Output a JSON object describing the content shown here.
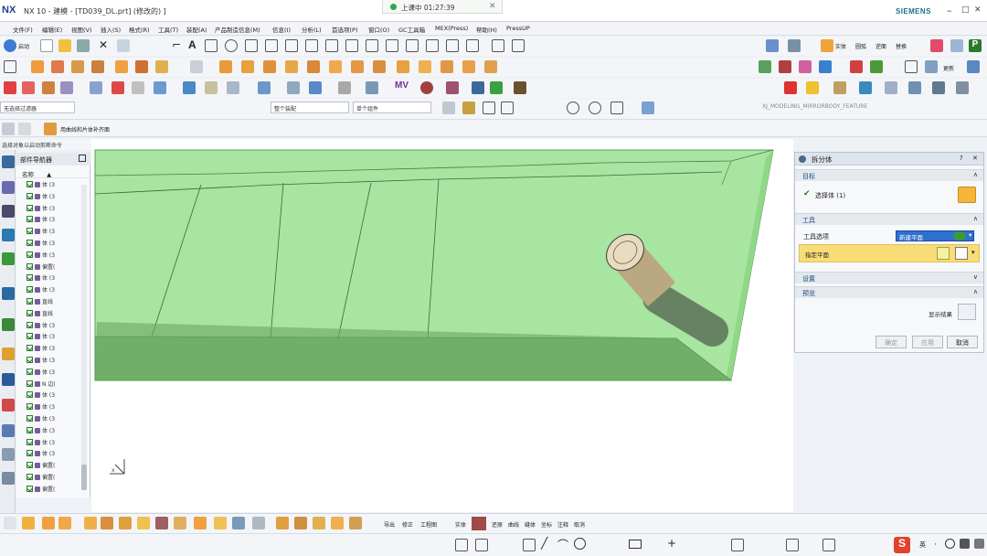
{
  "window": {
    "logo": "NX",
    "title": "NX 10 - 建模 - [TD039_DL.prt]  (修改的) ]",
    "brand": "SIEMENS",
    "minimize": "–",
    "maximize": "□",
    "close": "✕"
  },
  "recording": {
    "text": "上课中 01:27:39",
    "close": "✕"
  },
  "menu": [
    "文件(F)",
    "编辑(E)",
    "视图(V)",
    "插入(S)",
    "格式(R)",
    "工具(T)",
    "装配(A)",
    "产品制造信息(M)",
    "信息(I)",
    "分析(L)",
    "首选项(P)",
    "窗口(O)",
    "GC工具箱",
    "MEX(Press)",
    "帮助(H)",
    "PressUP"
  ],
  "toolbar_labels": {
    "start": "启动",
    "snap": "实体",
    "toggle": "圆弧",
    "reverse": "逆面",
    "replace": "替换",
    "insert": "图包",
    "view": "更新",
    "sel_feature": "XJ_MODELING_MIRRORBODY_FEATURE",
    "mv": "MV",
    "measure": "工程"
  },
  "selection": {
    "filter": "无选择过滤器",
    "scope": "整个装配",
    "section": "单个组件",
    "hint": "用曲线和片体补齐面",
    "status": "选择对象以启动剪断命令"
  },
  "navigator": {
    "title": "部件导航器",
    "col_name": "名称",
    "col_arrow": "▲",
    "rows": [
      "体 (3",
      "体 (3",
      "体 (3",
      "体 (3",
      "体 (3",
      "体 (3",
      "体 (3",
      "偏置(",
      "体 (3",
      "体 (3",
      "直线",
      "直线",
      "体 (3",
      "体 (3",
      "体 (3",
      "体 (3",
      "体 (3",
      "N 边(",
      "体 (3",
      "体 (3",
      "体 (3",
      "体 (3",
      "体 (3",
      "体 (3",
      "偏置(",
      "偏置(",
      "偏置("
    ]
  },
  "dialog": {
    "title": "拆分体",
    "help": "?",
    "close": "✕",
    "target": {
      "header": "目标",
      "item": "选择体 (1)"
    },
    "tool": {
      "header": "工具",
      "option_label": "工具选项",
      "option_value": "新建平面",
      "plane_label": "指定平面"
    },
    "settings": {
      "header": "设置"
    },
    "preview": {
      "header": "预览",
      "show_result": "显示结果"
    },
    "buttons": {
      "ok": "确定",
      "apply": "应用",
      "cancel": "取消"
    }
  },
  "bottom": {
    "labels": [
      "导出",
      "修正",
      "工程图"
    ],
    "right_labels": [
      "实体",
      "还原",
      "曲线",
      "缝体",
      "坐标",
      "注释",
      "取消"
    ],
    "ime": "英",
    "colors": {
      "accent_red": "#e0422a"
    }
  }
}
